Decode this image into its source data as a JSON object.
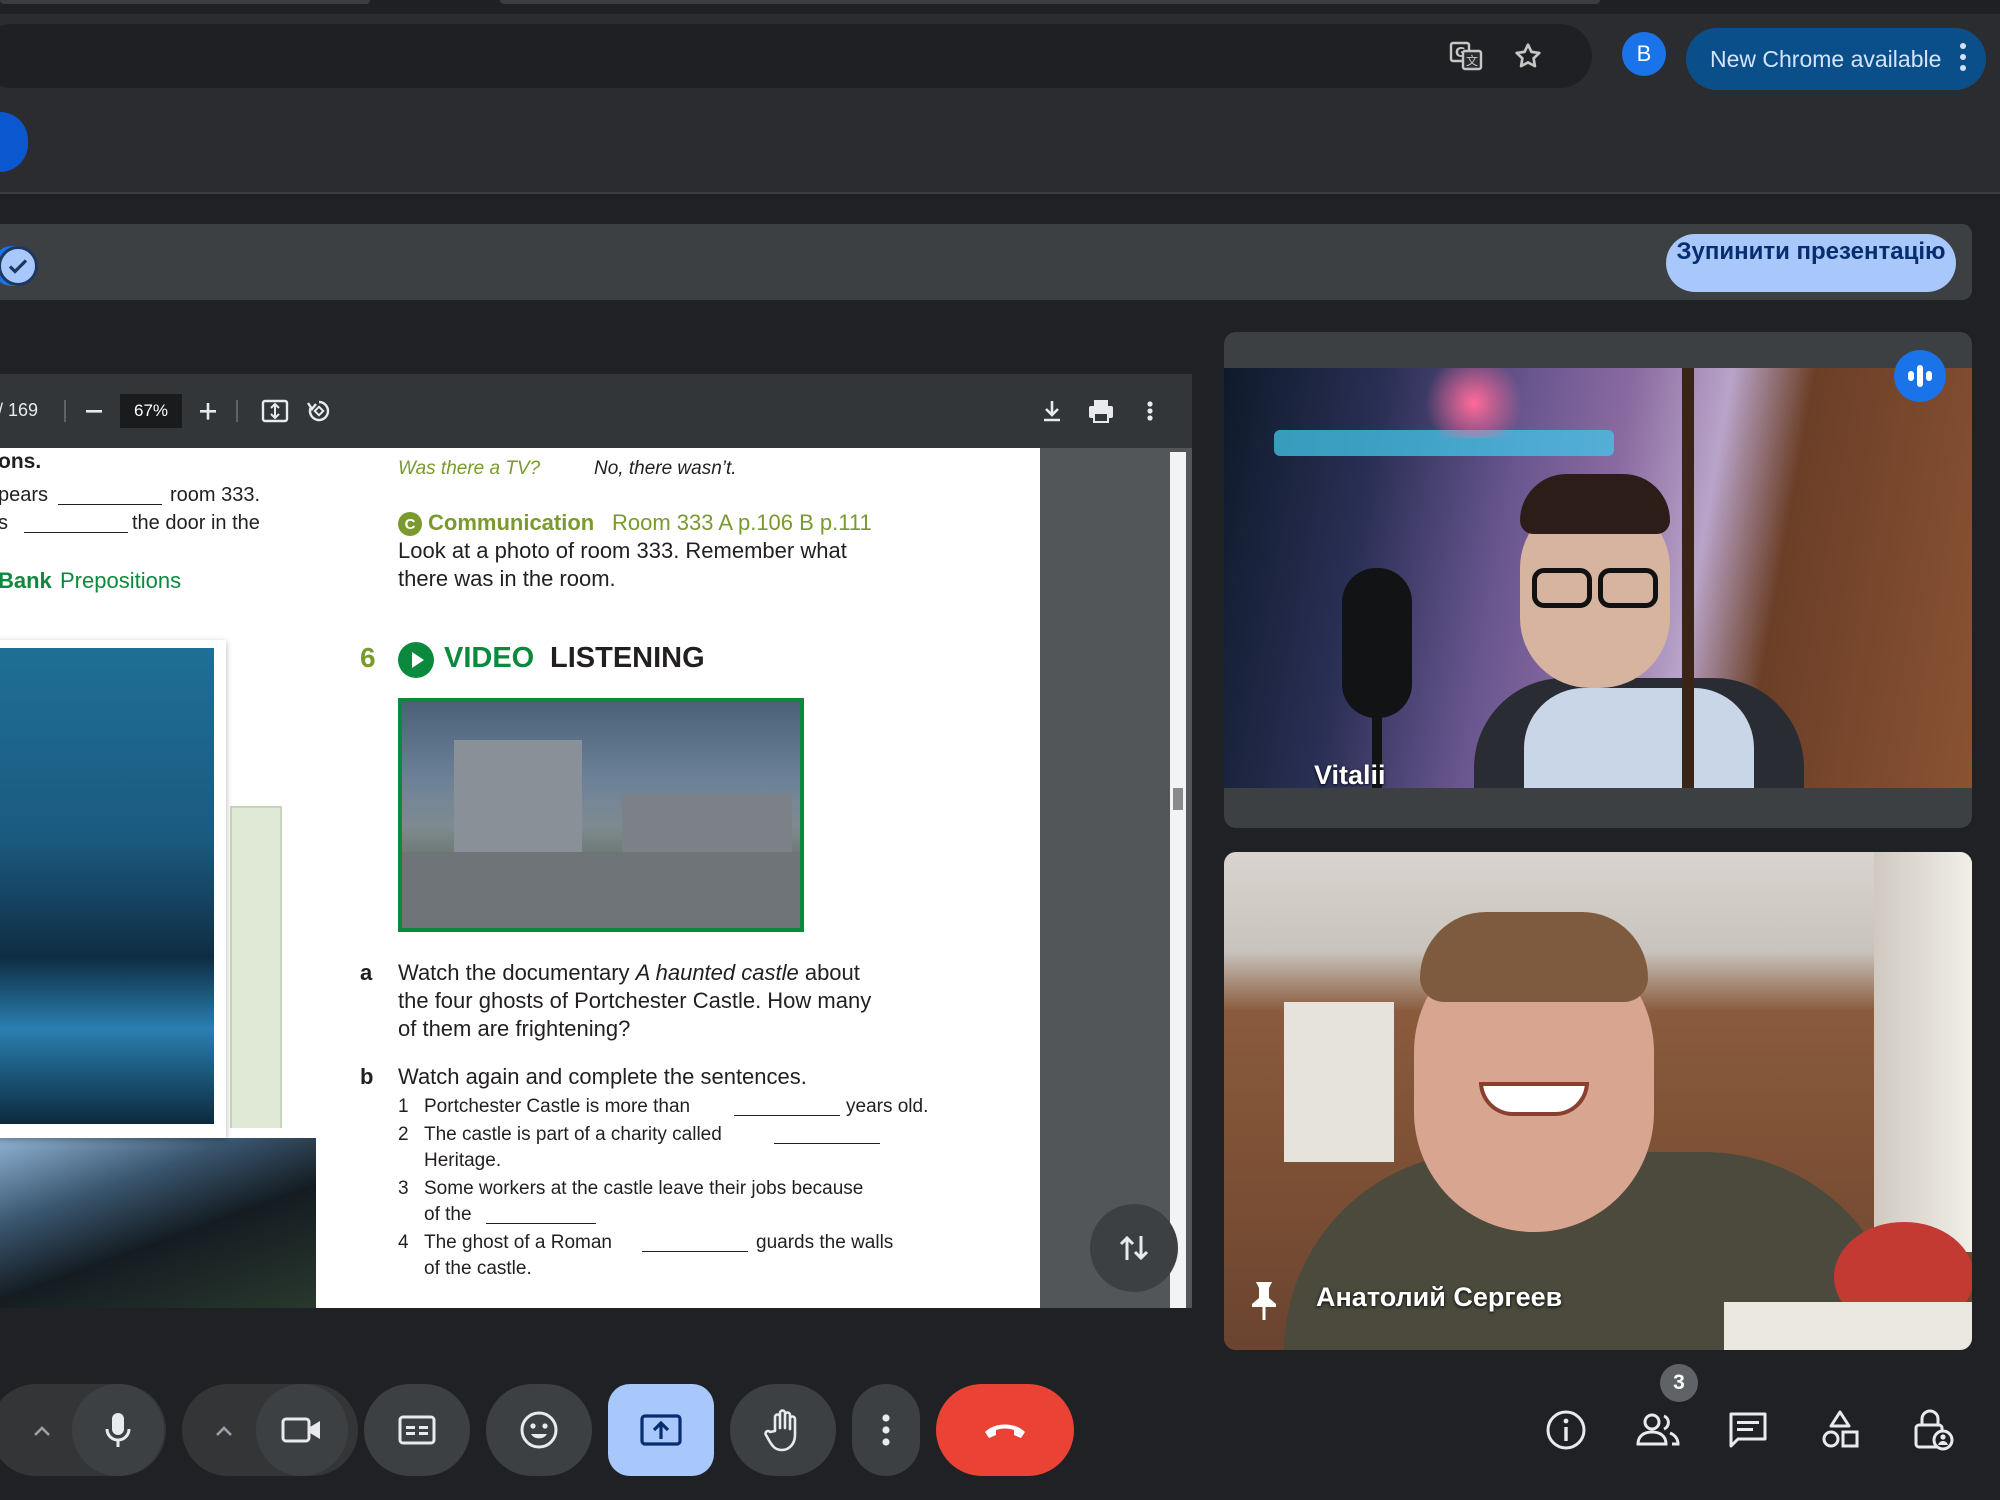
{
  "browser": {
    "new_chrome_label": "New Chrome available",
    "avatar_letter": "B"
  },
  "meet": {
    "stop_presenting_label": "Зупинити презентацію",
    "people_count": "3"
  },
  "pdf": {
    "page_counter": "/ 169",
    "zoom": "67%",
    "content": {
      "frag_ons": "ons.",
      "frag_pears_a": "pears",
      "frag_pears_b": "room 333.",
      "frag_s_a": "s",
      "frag_s_b": "the door in the",
      "word_bank_a": "Bank",
      "word_bank_b": "Prepositions",
      "was_tv": "Was there a TV?",
      "no_wasnt": "No, there wasn’t.",
      "comm_badge": "C",
      "comm_title": "Communication",
      "comm_ref": "Room 333 A p.106 B p.111",
      "comm_line1": "Look at a photo of room 333. Remember what",
      "comm_line2": "there was in the room.",
      "section_num": "6",
      "video_word": "VIDEO",
      "listening_word": "LISTENING",
      "a_letter": "a",
      "a_line1_pre": "Watch the documentary ",
      "a_line1_italic": "A haunted castle",
      "a_line1_post": " about",
      "a_line2": "the four ghosts of Portchester Castle. How many",
      "a_line3": "of them are frightening?",
      "b_letter": "b",
      "b_line": "Watch again and complete the sentences.",
      "s1_n": "1",
      "s1_a": "Portchester Castle is more than",
      "s1_b": "years old.",
      "s2_n": "2",
      "s2_a": "The castle is part of a charity called",
      "s2_c": "Heritage.",
      "s3_n": "3",
      "s3_a": "Some workers at the castle leave their jobs because",
      "s3_c": "of the",
      "s4_n": "4",
      "s4_a": "The ghost of a Roman",
      "s4_b": "guards the walls",
      "s4_c": "of the castle."
    }
  },
  "participants": [
    {
      "name": "Vitalii"
    },
    {
      "name": "Анатолий Сергеев"
    }
  ]
}
